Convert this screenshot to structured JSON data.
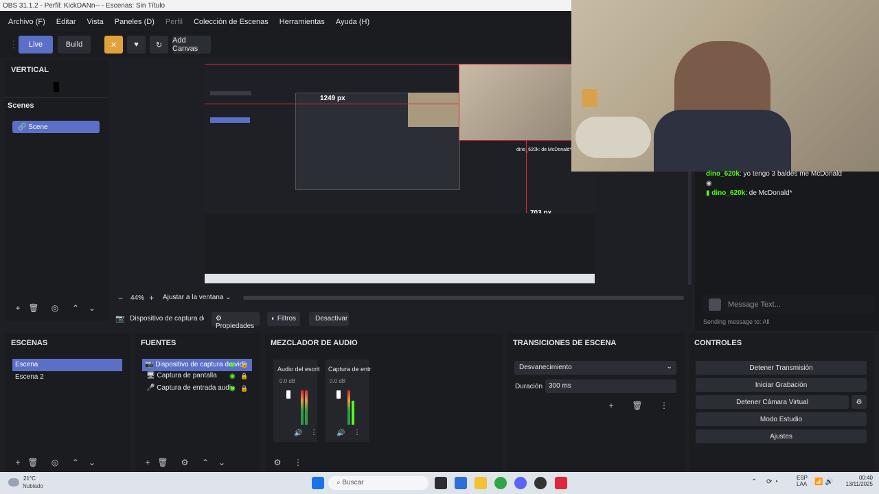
{
  "window": {
    "title": "OBS 31.1.2 - Perfil: KickDANn-- - Escenas: Sin Título"
  },
  "menu": [
    "Archivo (F)",
    "Editar",
    "Vista",
    "Paneles (D)",
    "Perfil",
    "Colección de Escenas",
    "Herramientas",
    "Ayuda (H)"
  ],
  "toolbar": {
    "live": "Live",
    "build": "Build",
    "add_canvas": "Add Canvas"
  },
  "vertical_panel": {
    "title": "VERTICAL",
    "scenes_label": "Scenes",
    "scene_item": "Scene"
  },
  "preview": {
    "width_label": "1249 px",
    "height_label": "703 px",
    "zoom": "44%",
    "fit": "Ajustar a la ventana"
  },
  "source_toolbar": {
    "source_name": "Dispositivo de captura de vi",
    "properties": "Propiedades",
    "filters": "Filtros",
    "deactivate": "Desactivar"
  },
  "chat": {
    "messages": [
      {
        "user": "dino_620k",
        "text": ": yo tengo 3 baldes me McDonald"
      },
      {
        "user": "dino_620k",
        "text": ": de McDonald*"
      }
    ],
    "input_placeholder": "Message Text...",
    "sending_to": "Sending message to: All",
    "overlay_text": "dino_620k: de McDonald*"
  },
  "docks": {
    "scenes": {
      "title": "ESCENAS",
      "items": [
        "Escena",
        "Escena 2"
      ]
    },
    "sources": {
      "title": "FUENTES",
      "items": [
        "Dispositivo de captura de vide",
        "Captura de pantalla",
        "Captura de entrada audio"
      ]
    },
    "mixer": {
      "title": "MEZCLADOR DE AUDIO",
      "channels": [
        {
          "name": "Audio del escrit",
          "db": "0.0 dB"
        },
        {
          "name": "Captura de entr",
          "db": "0.0 dB"
        }
      ]
    },
    "transitions": {
      "title": "TRANSICIONES DE ESCENA",
      "type": "Desvanecimiento",
      "duration_label": "Duración",
      "duration": "300 ms"
    },
    "controls": {
      "title": "CONTROLES",
      "buttons": [
        "Detener Transmisión",
        "Iniciar Grabación",
        "Detener Cámara Virtual",
        "Modo Estudio",
        "Ajustes"
      ]
    }
  },
  "taskbar": {
    "weather_temp": "21°C",
    "weather_desc": "Nublado",
    "search": "Buscar",
    "lang": "ESP",
    "lang2": "LAA",
    "time": "00:40",
    "date": "13/11/2025"
  },
  "colors": {
    "accent": "#5c6fc7",
    "orange": "#e0a23a",
    "red": "#e0263a",
    "chat_user": "#53fc18"
  }
}
